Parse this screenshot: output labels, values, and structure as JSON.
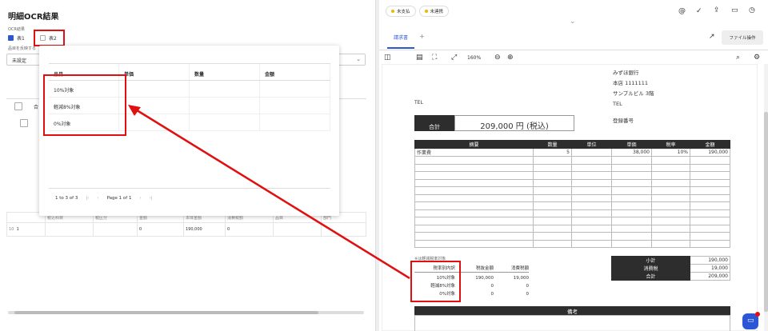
{
  "left": {
    "title": "明細OCR結果",
    "ocr_label": "OCR結果",
    "tab1": "表1",
    "tab2": "表2",
    "item_label": "品目を反映する",
    "select_value": "未設定",
    "header_cell": "合"
  },
  "popup": {
    "headers": [
      "品目",
      "単価",
      "数量",
      "金額"
    ],
    "rows": [
      "10%対象",
      "軽減8%対象",
      "0%対象"
    ],
    "pager": {
      "range": "1 to 3 of 3",
      "page": "Page 1 of 1"
    }
  },
  "grid": {
    "headers": [
      "税込科目",
      "税区分",
      "金額",
      "本体金額",
      "消費税額",
      "品目",
      "部門"
    ],
    "row": {
      "num": "10",
      "id": "1",
      "amount": "0",
      "body": "190,000",
      "tax": "0"
    }
  },
  "right": {
    "tags": [
      "未支払",
      "未連携"
    ],
    "tab": "請求書",
    "tab_add": "+",
    "file_btn": "ファイル操作",
    "zoom": "160%",
    "doc": {
      "bank": "みずほ銀行",
      "branch": "本店 1111111",
      "building": "サンプルビル 3階",
      "tel_left": "TEL",
      "tel_right": "TEL",
      "reg": "登録番号",
      "total_label": "合計",
      "total_value": "209,000 円 (税込)",
      "cols": [
        "摘要",
        "数量",
        "単位",
        "単価",
        "税率",
        "金額"
      ],
      "item": {
        "name": "作業費",
        "qty": "5",
        "unit": "",
        "price": "38,000",
        "rate": "10%",
        "amount": "190,000"
      },
      "note_small": "※は軽減税率対象",
      "breakdown_headers": [
        "税率別内訳",
        "税抜金額",
        "消費税額"
      ],
      "breakdown": [
        [
          "10%対象",
          "190,000",
          "19,000"
        ],
        [
          "軽減8%対象",
          "0",
          "0"
        ],
        [
          "0%対象",
          "0",
          "0"
        ]
      ],
      "summary": [
        [
          "小計",
          "190,000"
        ],
        [
          "消費税",
          "19,000"
        ],
        [
          "合計",
          "209,000"
        ]
      ],
      "remarks": "備考"
    }
  },
  "colors": {
    "red": "#e01010",
    "accent": "#2b57d6",
    "dark": "#2d2d2d"
  }
}
